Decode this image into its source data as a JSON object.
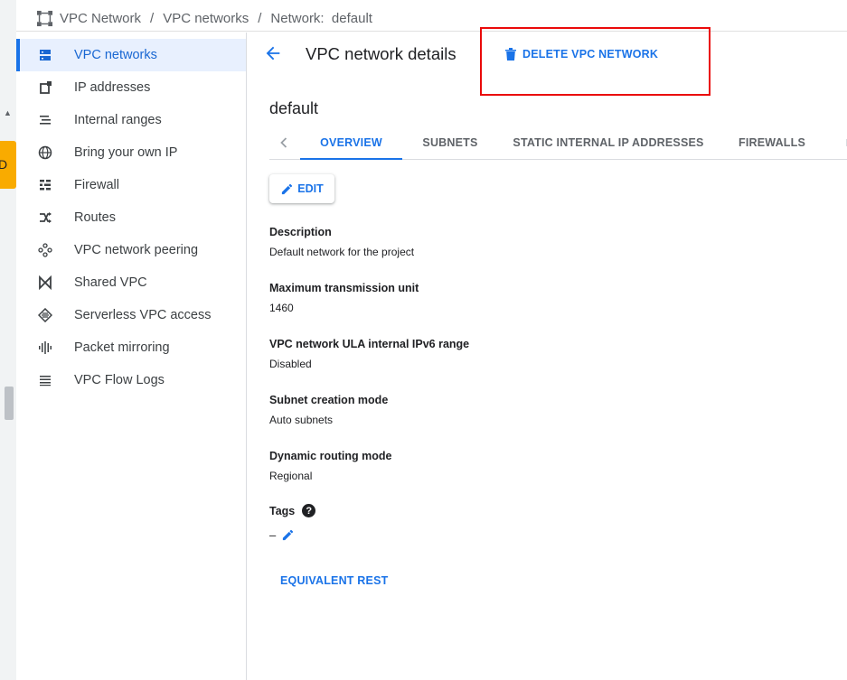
{
  "breadcrumb": {
    "items": [
      "VPC Network",
      "VPC networks",
      "Network:  default"
    ],
    "separator": "/"
  },
  "edge": {
    "toast_char": "D"
  },
  "sidebar": {
    "items": [
      {
        "label": "VPC networks",
        "icon": "vpc-networks-icon",
        "active": true
      },
      {
        "label": "IP addresses",
        "icon": "ip-addresses-icon"
      },
      {
        "label": "Internal ranges",
        "icon": "internal-ranges-icon"
      },
      {
        "label": "Bring your own IP",
        "icon": "globe-icon"
      },
      {
        "label": "Firewall",
        "icon": "firewall-icon"
      },
      {
        "label": "Routes",
        "icon": "routes-icon"
      },
      {
        "label": "VPC network peering",
        "icon": "peering-icon"
      },
      {
        "label": "Shared VPC",
        "icon": "shared-vpc-icon"
      },
      {
        "label": "Serverless VPC access",
        "icon": "serverless-icon"
      },
      {
        "label": "Packet mirroring",
        "icon": "packet-mirroring-icon"
      },
      {
        "label": "VPC Flow Logs",
        "icon": "flow-logs-icon"
      }
    ]
  },
  "header": {
    "title": "VPC network details",
    "delete_label": "DELETE VPC NETWORK"
  },
  "network": {
    "name": "default"
  },
  "tabs": [
    "OVERVIEW",
    "SUBNETS",
    "STATIC INTERNAL IP ADDRESSES",
    "FIREWALLS"
  ],
  "edit_label": "EDIT",
  "details": {
    "description_label": "Description",
    "description_value": "Default network for the project",
    "mtu_label": "Maximum transmission unit",
    "mtu_value": "1460",
    "ula_label": "VPC network ULA internal IPv6 range",
    "ula_value": "Disabled",
    "subnet_mode_label": "Subnet creation mode",
    "subnet_mode_value": "Auto subnets",
    "routing_label": "Dynamic routing mode",
    "routing_value": "Regional",
    "tags_label": "Tags",
    "tags_help": "?",
    "tags_value": "–"
  },
  "equivalent_rest_label": "EQUIVALENT REST",
  "colors": {
    "accent": "#1a73e8",
    "active_bg": "#e8f0fe",
    "highlight": "#ea0a0a",
    "toast": "#f9ab00"
  }
}
